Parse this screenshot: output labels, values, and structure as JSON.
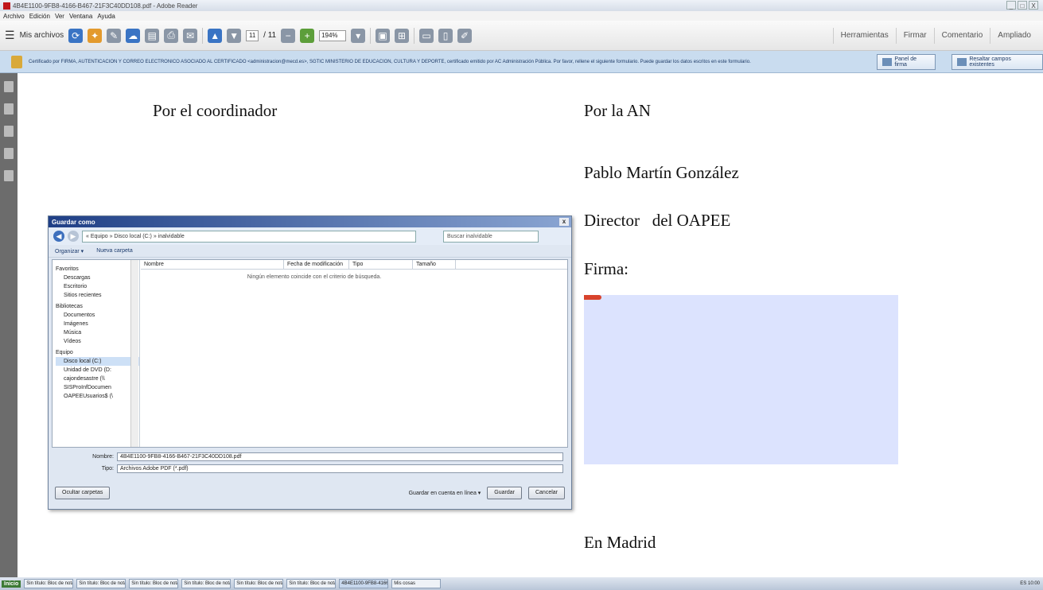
{
  "window": {
    "title": "4B4E1100-9FB8-4166-B467-21F3C40DD108.pdf - Adobe Reader",
    "controls": [
      "_",
      "□",
      "X"
    ]
  },
  "menubar": [
    "Archivo",
    "Edición",
    "Ver",
    "Ventana",
    "Ayuda"
  ],
  "toolbar": {
    "files_label": "Mis archivos",
    "page_current": "11",
    "page_total": "/ 11",
    "zoom": "194%",
    "right": [
      "Herramientas",
      "Firmar",
      "Comentario",
      "Ampliado"
    ]
  },
  "infobar": {
    "message": "Certificado por FIRMA, AUTENTICACION Y CORREO ELECTRONICO ASOCIADO AL CERTIFICADO <administracion@mecd.es>, SGTIC MINISTERIO DE EDUCACION, CULTURA Y DEPORTE, certificado emitido por AC Administración Pública. Por favor, rellene el siguiente formulario. Puede guardar los datos escritos en este formulario.",
    "panel_button": "Panel de firma",
    "highlight_button": "Resaltar campos existentes"
  },
  "document": {
    "left_heading": "Por el coordinador",
    "right_heading": "Por la AN",
    "name": "Pablo Martín González",
    "role": "Director   del OAPEE",
    "signature_label": "Firma:",
    "place": "En Madrid"
  },
  "dialog": {
    "title": "Guardar como",
    "address": "« Equipo » Disco local (C:) » inalvidable",
    "search_placeholder": "Buscar inalvidable",
    "organize": "Organizar ▾",
    "new_folder": "Nueva carpeta",
    "nav": {
      "favorites": "Favoritos",
      "favorites_items": [
        "Descargas",
        "Escritorio",
        "Sitios recientes"
      ],
      "libraries": "Bibliotecas",
      "library_items": [
        "Documentos",
        "Imágenes",
        "Música",
        "Vídeos"
      ],
      "computer": "Equipo",
      "computer_items": [
        "Disco local (C:)",
        "Unidad de DVD (D:",
        "cajondesastre (\\\\",
        "SISProInfDocumen",
        "OAPEEUsuarios$ (\\"
      ]
    },
    "columns": [
      "Nombre",
      "Fecha de modificación",
      "Tipo",
      "Tamaño"
    ],
    "empty_message": "Ningún elemento coincide con el criterio de búsqueda.",
    "filename_label": "Nombre:",
    "filename_value": "4B4E1100-9FB8-4166-B467-21F3C40DD108.pdf",
    "type_label": "Tipo:",
    "type_value": "Archivos Adobe PDF (*.pdf)",
    "hide_folders": "Ocultar carpetas",
    "save_online": "Guardar en cuenta en línea ▾",
    "save": "Guardar",
    "cancel": "Cancelar"
  },
  "taskbar": {
    "start": "Inicio",
    "tasks": [
      "Sin título: Bloc de notas",
      "Sin título: Bloc de notas",
      "Sin título: Bloc de notas",
      "Sin título: Bloc de notas",
      "Sin título: Bloc de notas",
      "Sin título: Bloc de notas",
      "4B4E1100-9FB8-4166...",
      "Mis cosas"
    ],
    "clock": "10:00",
    "lang": "ES"
  }
}
